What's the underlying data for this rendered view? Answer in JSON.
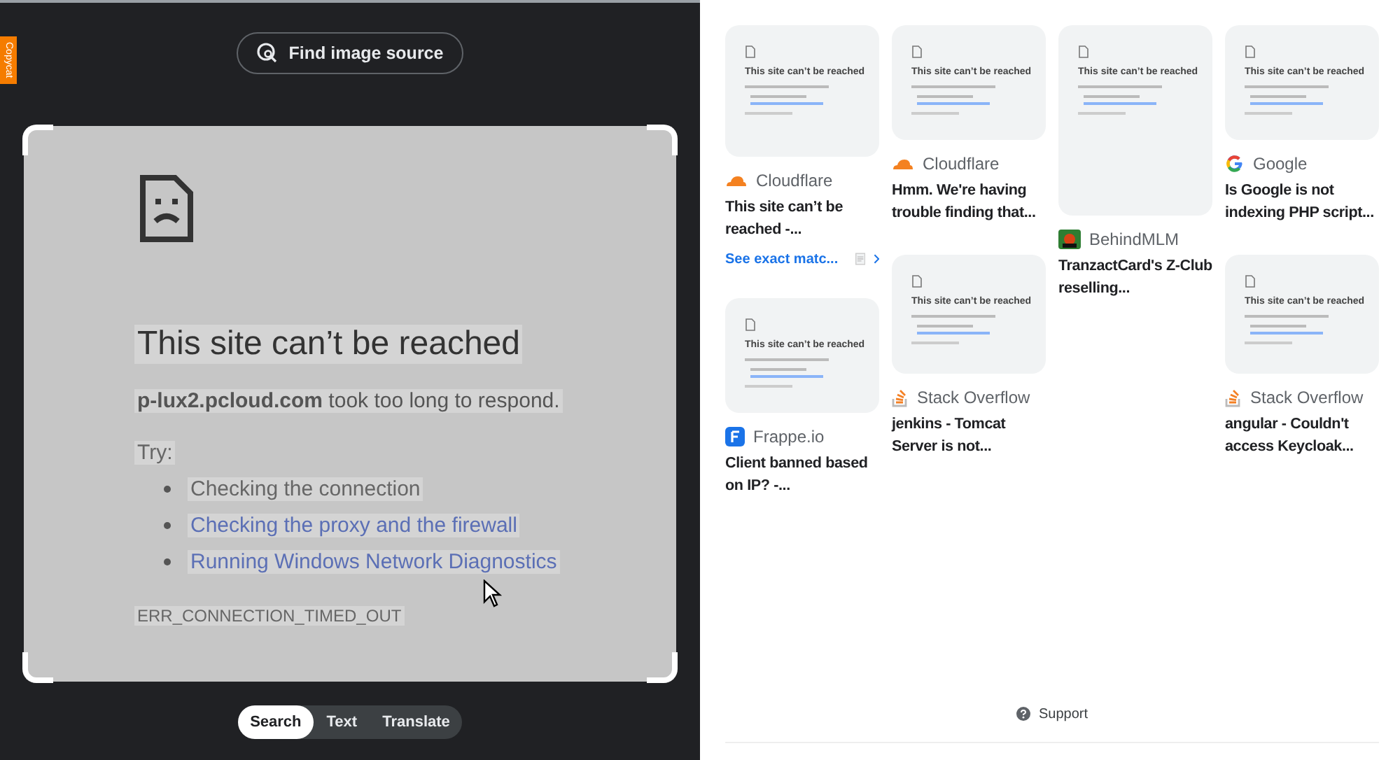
{
  "side_tab": "Copycat",
  "find_button": "Find image source",
  "selected_image": {
    "title": "This site can’t be reached",
    "message": "**p-lux2.pcloud.com** took too long to respond.",
    "try_label": "Try:",
    "suggestions": [
      {
        "text": "Checking the connection",
        "link": false
      },
      {
        "text": "Checking the proxy and the firewall",
        "link": true
      },
      {
        "text": "Running Windows Network Diagnostics",
        "link": true
      }
    ],
    "error_code": "ERR_CONNECTION_TIMED_OUT"
  },
  "mode_tabs": [
    {
      "label": "Search",
      "selected": true
    },
    {
      "label": "Text",
      "selected": false
    },
    {
      "label": "Translate",
      "selected": false
    }
  ],
  "results": [
    [
      {
        "thumb_title": "This site can’t be reached",
        "kind": "cloudflare",
        "source": "Cloudflare",
        "title": "This site can’t be reached -...",
        "link": "See exact matc..."
      },
      {
        "thumb_title": "This site can’t be reached",
        "kind": "frappe",
        "source": "Frappe.io",
        "title": "Client banned based on IP? -..."
      }
    ],
    [
      {
        "thumb_title": "This site can’t be reached",
        "kind": "cloudflare",
        "source": "Cloudflare",
        "title": "Hmm. We're having trouble finding that..."
      },
      {
        "thumb_title": "This site can’t be reached",
        "kind": "stackoverflow",
        "source": "Stack Overflow",
        "title": "jenkins - Tomcat Server is not..."
      }
    ],
    [
      {
        "thumb_title": "This site can’t be reached",
        "kind": "behindmlm",
        "source": "BehindMLM",
        "title": "TranzactCard's Z-Club reselling..."
      }
    ],
    [
      {
        "thumb_title": "This site can’t be reached",
        "kind": "google",
        "source": "Google",
        "title": "Is Google is not indexing PHP script..."
      },
      {
        "thumb_title": "This site can’t be reached",
        "kind": "stackoverflow",
        "source": "Stack Overflow",
        "title": "angular - Couldn't access Keycloak..."
      }
    ]
  ],
  "support": "Support"
}
